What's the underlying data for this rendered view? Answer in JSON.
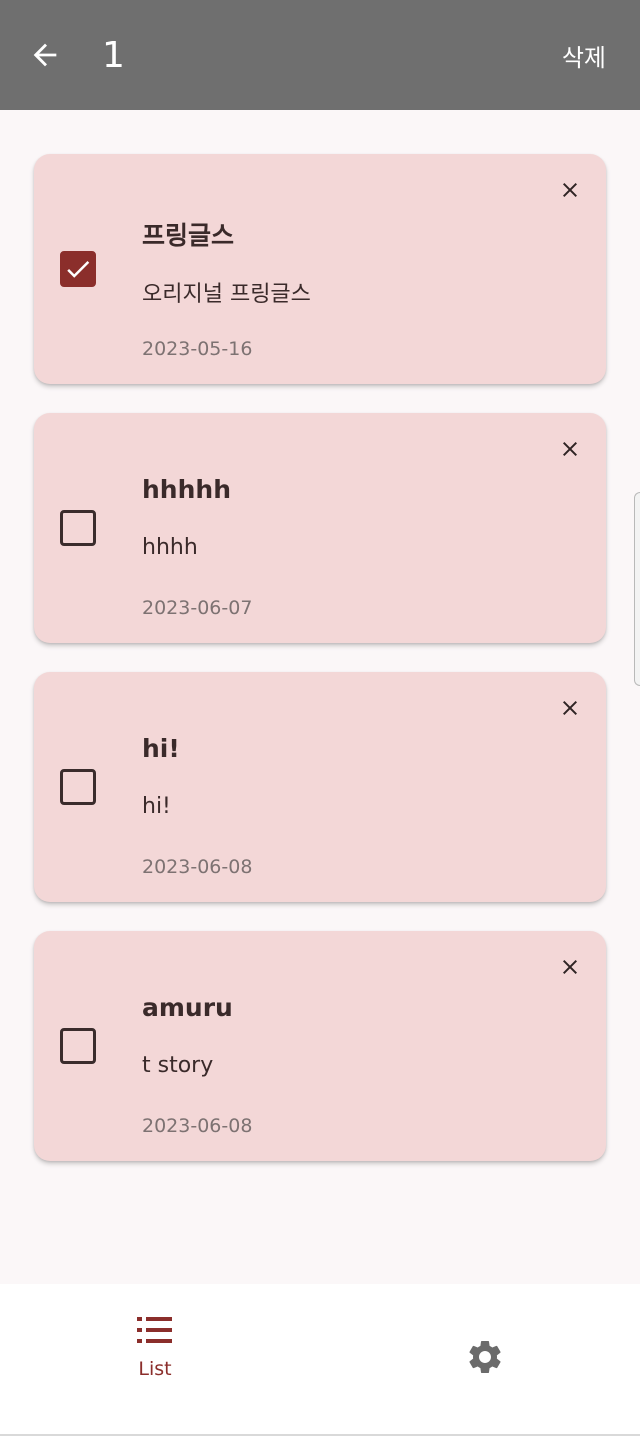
{
  "header": {
    "title": "1",
    "delete_label": "삭제",
    "back_icon": "arrow-back-icon"
  },
  "memos": [
    {
      "title": "프링글스",
      "body": "오리지널 프링글스",
      "date": "2023-05-16",
      "checked": true
    },
    {
      "title": "hhhhh",
      "body": "hhhh",
      "date": "2023-06-07",
      "checked": false
    },
    {
      "title": "hi!",
      "body": "hi!",
      "date": "2023-06-08",
      "checked": false
    },
    {
      "title": "amuru",
      "body": "t story",
      "date": "2023-06-08",
      "checked": false
    }
  ],
  "bottom_nav": {
    "items": [
      {
        "label": "List",
        "icon": "list-icon",
        "active": true
      },
      {
        "label": "",
        "icon": "gear-icon",
        "active": false
      }
    ]
  },
  "colors": {
    "app_bar": "#6f6f6f",
    "card_bg": "#f3d7d7",
    "accent": "#8b2e2b",
    "background": "#fbf7f8"
  }
}
